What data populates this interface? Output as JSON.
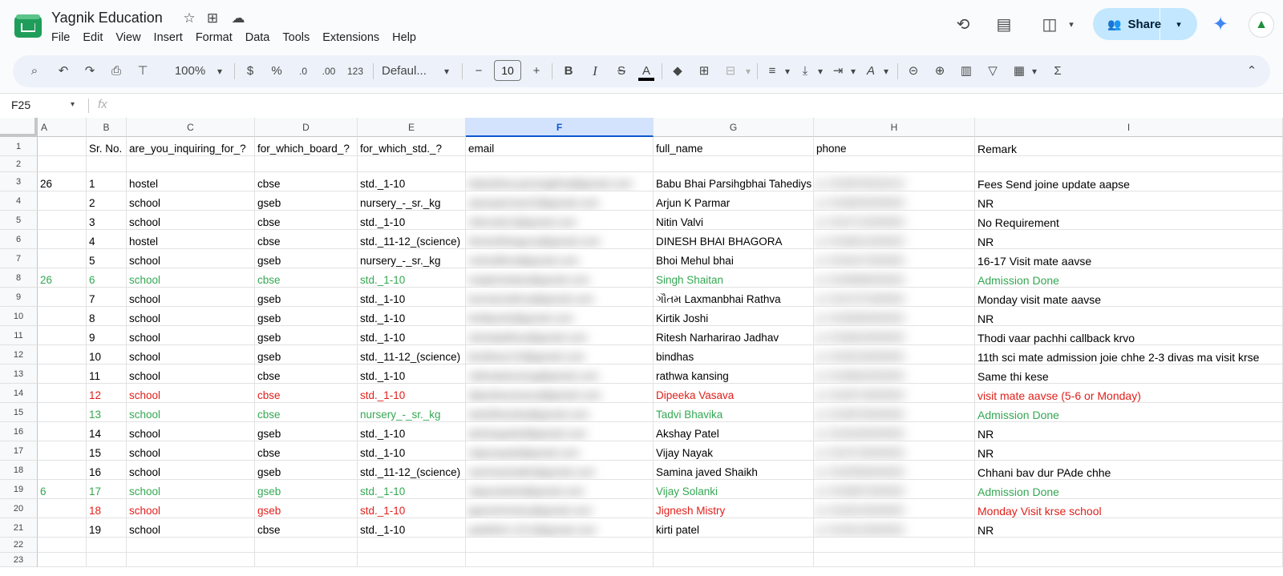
{
  "app": {
    "doc_title": "Yagnik Education",
    "menus": [
      "File",
      "Edit",
      "View",
      "Insert",
      "Format",
      "Data",
      "Tools",
      "Extensions",
      "Help"
    ],
    "share_label": "Share"
  },
  "icons": {
    "star": "☆",
    "move": "⊞",
    "cloud": "☁",
    "history": "⟲",
    "comment": "▤",
    "meet": "◫",
    "caret": "▾",
    "search": "⌕",
    "undo": "↶",
    "redo": "↷",
    "print": "⎙",
    "paint": "⊤",
    "dollar": "$",
    "percent": "%",
    "dec_less": ".0",
    "dec_more": ".00",
    "number_format": "123",
    "minus": "−",
    "plus": "+",
    "bold": "B",
    "italic": "I",
    "strike": "S",
    "text_color": "A",
    "fill": "◆",
    "borders": "⊞",
    "merge": "⊟",
    "align": "≡",
    "valign": "⤓",
    "wrap": "⇥",
    "rotate": "A",
    "link": "⊝",
    "add_comment": "⊕",
    "chart": "▥",
    "filter": "▽",
    "views": "▦",
    "functions": "Σ",
    "collapse": "⌃",
    "gemini": "✦",
    "avatar": "▲"
  },
  "toolbar": {
    "zoom": "100%",
    "font": "Defaul...",
    "font_size": "10"
  },
  "formula_bar": {
    "cell_ref": "F25",
    "fx": "fx",
    "value": ""
  },
  "sheet": {
    "selected_column": "F",
    "columns": [
      "A",
      "B",
      "C",
      "D",
      "E",
      "F",
      "G",
      "H",
      "I"
    ],
    "row_numbers": [
      "1",
      "2",
      "3",
      "4",
      "5",
      "6",
      "7",
      "8",
      "9",
      "10",
      "11",
      "12",
      "13",
      "14",
      "15",
      "16",
      "17",
      "18",
      "19",
      "20",
      "21",
      "22",
      "23"
    ],
    "rows": [
      {
        "color": "",
        "cells": [
          "",
          "Sr. No.",
          "are_you_inquiring_for_?",
          "for_which_board_?",
          "for_which_std._?",
          "email",
          "full_name",
          "phone",
          "Remark"
        ]
      },
      {
        "color": "",
        "cells": [
          "",
          "",
          "",
          "",
          "",
          "",
          "",
          "",
          ""
        ]
      },
      {
        "color": "",
        "cells": [
          "26",
          "1",
          "hostel",
          "cbse",
          "std._1-10",
          "babubhai.parsingbhai@gmail.com",
          "Babu Bhai Parsihgbhai Tahediys",
          "p:+919876543210",
          "Fees Send joine update aapse"
        ]
      },
      {
        "color": "",
        "cells": [
          "",
          "2",
          "school",
          "gseb",
          "nursery_-_sr._kg",
          "arjunparmar22@gmail.com",
          "Arjun K Parmar",
          "p:+919825000000",
          "NR"
        ]
      },
      {
        "color": "",
        "cells": [
          "",
          "3",
          "school",
          "cbse",
          "std._1-10",
          "nitinvalvi1@gmail.com",
          "Nitin Valvi",
          "p:+919712000000",
          "No Requirement"
        ]
      },
      {
        "color": "",
        "cells": [
          "",
          "4",
          "hostel",
          "cbse",
          "std._11-12_(science)",
          "dineshbhagora@gmail.com",
          "DINESH BHAI BHAGORA",
          "p:+919601000000",
          "NR"
        ]
      },
      {
        "color": "",
        "cells": [
          "",
          "5",
          "school",
          "gseb",
          "nursery_-_sr._kg",
          "mehulbhoi@gmail.com",
          "Bhoi Mehul bhai",
          "p:+919427000000",
          "16-17 Visit mate aavse"
        ]
      },
      {
        "color": "green",
        "cells": [
          "26",
          "6",
          "school",
          "cbse",
          "std._1-10",
          "singhshaitan@gmail.com",
          "Singh Shaitan",
          "p:+919898000000",
          "Admission Done"
        ]
      },
      {
        "color": "",
        "cells": [
          "",
          "7",
          "school",
          "gseb",
          "std._1-10",
          "laxmanrathva@gmail.com",
          "ગૌતમ Laxmanbhai Rathva",
          "p:+919737000000",
          "Monday visit mate aavse"
        ]
      },
      {
        "color": "",
        "cells": [
          "",
          "8",
          "school",
          "gseb",
          "std._1-10",
          "kirtikjoshi@gmail.com",
          "Kirtik Joshi",
          "p:+919909000000",
          "NR"
        ]
      },
      {
        "color": "",
        "cells": [
          "",
          "9",
          "school",
          "gseb",
          "std._1-10",
          "riteshjadhav@gmail.com",
          "Ritesh Narharirao Jadhav",
          "p:+919824000000",
          "Thodi vaar pachhi callback krvo"
        ]
      },
      {
        "color": "",
        "cells": [
          "",
          "10",
          "school",
          "gseb",
          "std._11-12_(science)",
          "bindhas123@gmail.com",
          "bindhas",
          "p:+919016000000",
          "11th sci mate admission joie chhe 2-3 divas ma visit krse"
        ]
      },
      {
        "color": "",
        "cells": [
          "",
          "11",
          "school",
          "cbse",
          "std._1-10",
          "rathwakansing@gmail.com",
          "rathwa kansing",
          "p:+919662000000",
          "Same thi kese"
        ]
      },
      {
        "color": "red",
        "cells": [
          "",
          "12",
          "school",
          "cbse",
          "std._1-10",
          "dipeekavasava@gmail.com",
          "Dipeeka Vasava",
          "p:+919574000000",
          "visit mate aavse (5-6 or Monday)"
        ]
      },
      {
        "color": "green",
        "cells": [
          "",
          "13",
          "school",
          "cbse",
          "nursery_-_sr._kg",
          "tadvibhavika@gmail.com",
          "Tadvi Bhavika",
          "p:+919879000000",
          "Admission Done"
        ]
      },
      {
        "color": "",
        "cells": [
          "",
          "14",
          "school",
          "gseb",
          "std._1-10",
          "akshaypatel@gmail.com",
          "Akshay Patel",
          "p:+919426000000",
          "NR"
        ]
      },
      {
        "color": "",
        "cells": [
          "",
          "15",
          "school",
          "cbse",
          "std._1-10",
          "vijaynayak@gmail.com",
          "Vijay Nayak",
          "p:+919723000000",
          "NR"
        ]
      },
      {
        "color": "",
        "cells": [
          "",
          "16",
          "school",
          "gseb",
          "std._11-12_(science)",
          "saminashaikh@gmail.com",
          "Samina javed Shaikh",
          "p:+919558000000",
          "Chhani bav dur PAde chhe"
        ]
      },
      {
        "color": "green",
        "cells": [
          "6",
          "17",
          "school",
          "gseb",
          "std._1-10",
          "vijaysolanki@gmail.com",
          "Vijay Solanki",
          "p:+919687000000",
          "Admission Done"
        ]
      },
      {
        "color": "red",
        "cells": [
          "",
          "18",
          "school",
          "gseb",
          "std._1-10",
          "jigneshmistry@gmail.com",
          "Jignesh Mistry",
          "p:+919510000000",
          "Monday Visit krse school"
        ]
      },
      {
        "color": "",
        "cells": [
          "",
          "19",
          "school",
          "cbse",
          "std._1-10",
          "patelkirti.1212@gmail.com",
          "kirti patel",
          "p:+919313000000",
          "NR"
        ]
      },
      {
        "color": "",
        "cells": [
          "",
          "",
          "",
          "",
          "",
          "",
          "",
          "",
          ""
        ]
      },
      {
        "color": "",
        "cells": [
          "",
          "",
          "",
          "",
          "",
          "",
          "",
          "",
          ""
        ]
      }
    ]
  }
}
